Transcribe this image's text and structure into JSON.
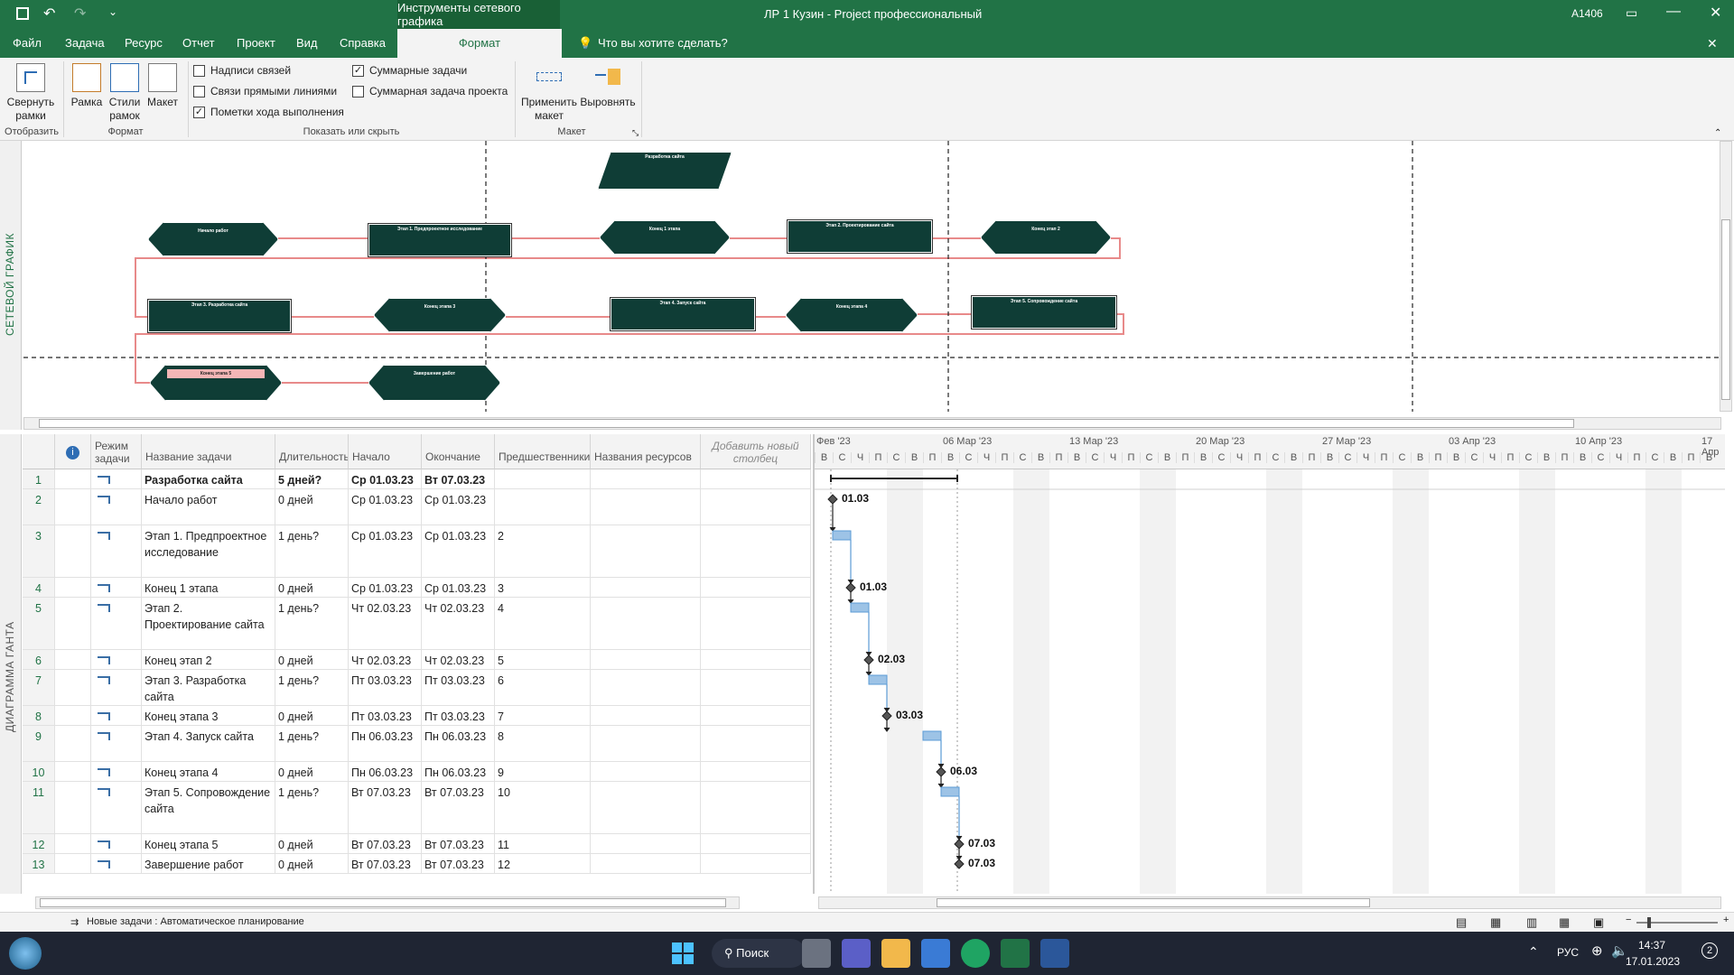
{
  "titlebar": {
    "context_tab": "Инструменты сетевого графика",
    "title": "ЛР 1 Кузин  -  Project профессиональный",
    "user": "A1406"
  },
  "tabs": [
    "Файл",
    "Задача",
    "Ресурс",
    "Отчет",
    "Проект",
    "Вид",
    "Справка"
  ],
  "active_tab": "Формат",
  "tell_me": "Что вы хотите сделать?",
  "ribbon": {
    "collapse_label": "Свернуть рамки",
    "group_show": "Отобразить",
    "box_label": "Рамка",
    "box_styles_label": "Стили рамок",
    "layout_label": "Макет",
    "group_format": "Формат",
    "checks": [
      {
        "label": "Надписи связей",
        "checked": false
      },
      {
        "label": "Связи прямыми линиями",
        "checked": false
      },
      {
        "label": "Пометки хода выполнения",
        "checked": true
      },
      {
        "label": "Суммарные задачи",
        "checked": true
      },
      {
        "label": "Суммарная задача проекта",
        "checked": false
      }
    ],
    "group_showhide": "Показать или скрыть",
    "apply_layout": "Применить макет",
    "align_label": "Выровнять",
    "group_layout": "Макет"
  },
  "net_label": "СЕТЕВОЙ ГРАФИК",
  "gantt_label": "ДИАГРАММА ГАНТА",
  "nodes": [
    {
      "id": "n0",
      "title": "Разработка сайта"
    },
    {
      "id": "n1",
      "title": "Начало работ"
    },
    {
      "id": "n2",
      "title": "Этап 1. Предпроектное исследование"
    },
    {
      "id": "n3",
      "title": "Конец 1 этапа"
    },
    {
      "id": "n4",
      "title": "Этап 2. Проектирование сайта"
    },
    {
      "id": "n5",
      "title": "Конец этап 2"
    },
    {
      "id": "n6",
      "title": "Этап 3. Разработка сайта"
    },
    {
      "id": "n7",
      "title": "Конец этапа 3"
    },
    {
      "id": "n8",
      "title": "Этап 4. Запуск сайта"
    },
    {
      "id": "n9",
      "title": "Конец этапа 4"
    },
    {
      "id": "n10",
      "title": "Этап 5. Сопровождение сайта"
    },
    {
      "id": "n11",
      "title": "Конец этапа 5"
    },
    {
      "id": "n12",
      "title": "Завершение работ"
    }
  ],
  "columns": {
    "mode": "Режим задачи",
    "name": "Название задачи",
    "duration": "Длительность",
    "start": "Начало",
    "finish": "Окончание",
    "pred": "Предшественники",
    "resources": "Названия ресурсов",
    "add": "Добавить новый столбец"
  },
  "rows": [
    {
      "n": "1",
      "name": "Разработка сайта",
      "dur": "5 дней?",
      "start": "Ср 01.03.23",
      "finish": "Вт 07.03.23",
      "pred": "",
      "bold": true
    },
    {
      "n": "2",
      "name": "Начало работ",
      "dur": "0 дней",
      "start": "Ср 01.03.23",
      "finish": "Ср 01.03.23",
      "pred": ""
    },
    {
      "n": "3",
      "name": "Этап 1. Предпроектное исследование",
      "dur": "1 день?",
      "start": "Ср 01.03.23",
      "finish": "Ср 01.03.23",
      "pred": "2"
    },
    {
      "n": "4",
      "name": "Конец 1 этапа",
      "dur": "0 дней",
      "start": "Ср 01.03.23",
      "finish": "Ср 01.03.23",
      "pred": "3"
    },
    {
      "n": "5",
      "name": "Этап 2. Проектирование сайта",
      "dur": "1 день?",
      "start": "Чт 02.03.23",
      "finish": "Чт 02.03.23",
      "pred": "4"
    },
    {
      "n": "6",
      "name": "Конец этап 2",
      "dur": "0 дней",
      "start": "Чт 02.03.23",
      "finish": "Чт 02.03.23",
      "pred": "5"
    },
    {
      "n": "7",
      "name": "Этап 3. Разработка сайта",
      "dur": "1 день?",
      "start": "Пт 03.03.23",
      "finish": "Пт 03.03.23",
      "pred": "6"
    },
    {
      "n": "8",
      "name": "Конец этапа 3",
      "dur": "0 дней",
      "start": "Пт 03.03.23",
      "finish": "Пт 03.03.23",
      "pred": "7"
    },
    {
      "n": "9",
      "name": "Этап 4. Запуск сайта",
      "dur": "1 день?",
      "start": "Пн 06.03.23",
      "finish": "Пн 06.03.23",
      "pred": "8"
    },
    {
      "n": "10",
      "name": "Конец этапа 4",
      "dur": "0 дней",
      "start": "Пн 06.03.23",
      "finish": "Пн 06.03.23",
      "pred": "9"
    },
    {
      "n": "11",
      "name": "Этап 5. Сопровождение сайта",
      "dur": "1 день?",
      "start": "Вт 07.03.23",
      "finish": "Вт 07.03.23",
      "pred": "10"
    },
    {
      "n": "12",
      "name": "Конец этапа 5",
      "dur": "0 дней",
      "start": "Вт 07.03.23",
      "finish": "Вт 07.03.23",
      "pred": "11"
    },
    {
      "n": "13",
      "name": "Завершение работ",
      "dur": "0 дней",
      "start": "Вт 07.03.23",
      "finish": "Вт 07.03.23",
      "pred": "12"
    }
  ],
  "timescale": {
    "weeks": [
      "Фев '23",
      "06 Мар '23",
      "13 Мар '23",
      "20 Мар '23",
      "27 Мар '23",
      "03 Апр '23",
      "10 Апр '23",
      "17 Апр"
    ],
    "days": [
      "В",
      "С",
      "Ч",
      "П",
      "С",
      "В",
      "П"
    ]
  },
  "milestone_labels": [
    "01.03",
    "01.03",
    "02.03",
    "03.03",
    "06.03",
    "07.03",
    "07.03"
  ],
  "status": "Новые задачи : Автоматическое планирование",
  "taskbar": {
    "search": "Поиск",
    "lang": "РУС",
    "time": "14:37",
    "date": "17.01.2023",
    "badge": "2"
  }
}
